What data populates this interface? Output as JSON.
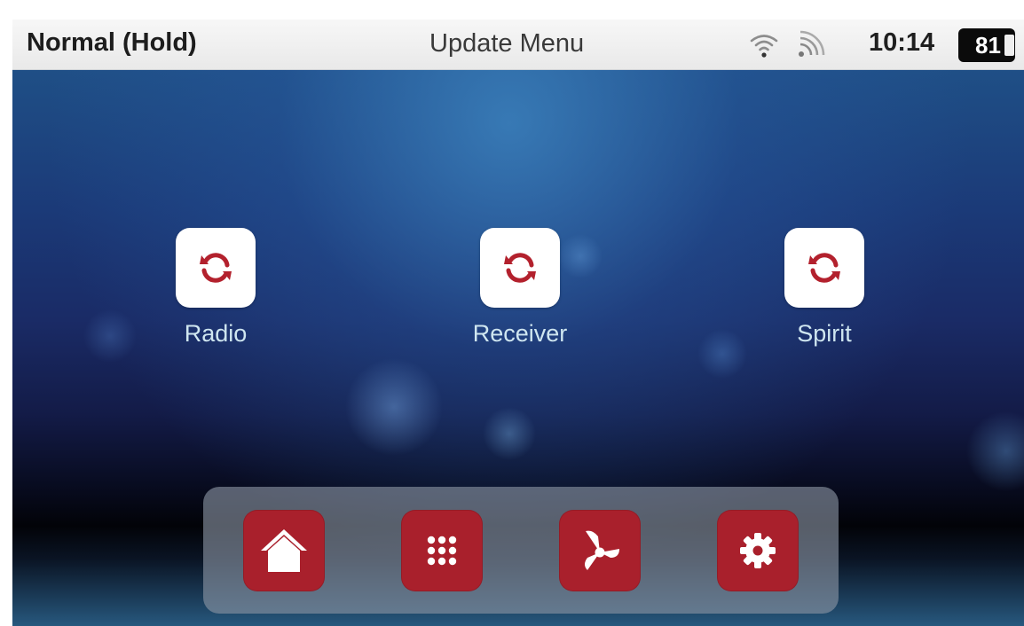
{
  "status_bar": {
    "mode": "Normal (Hold)",
    "title": "Update Menu",
    "time": "10:14",
    "battery_percent": "81",
    "icons": [
      "wifi-icon",
      "signal-icon"
    ]
  },
  "apps": [
    {
      "label": "Radio",
      "icon": "refresh-icon"
    },
    {
      "label": "Receiver",
      "icon": "refresh-icon"
    },
    {
      "label": "Spirit",
      "icon": "refresh-icon"
    }
  ],
  "dock": {
    "items": [
      {
        "icon": "home-icon"
      },
      {
        "icon": "grid-icon"
      },
      {
        "icon": "fan-icon"
      },
      {
        "icon": "gear-icon"
      }
    ]
  },
  "colors": {
    "accent_red": "#a9202c",
    "label_text": "#cfe6f0",
    "status_bar_bg": "#f0f0f0"
  }
}
